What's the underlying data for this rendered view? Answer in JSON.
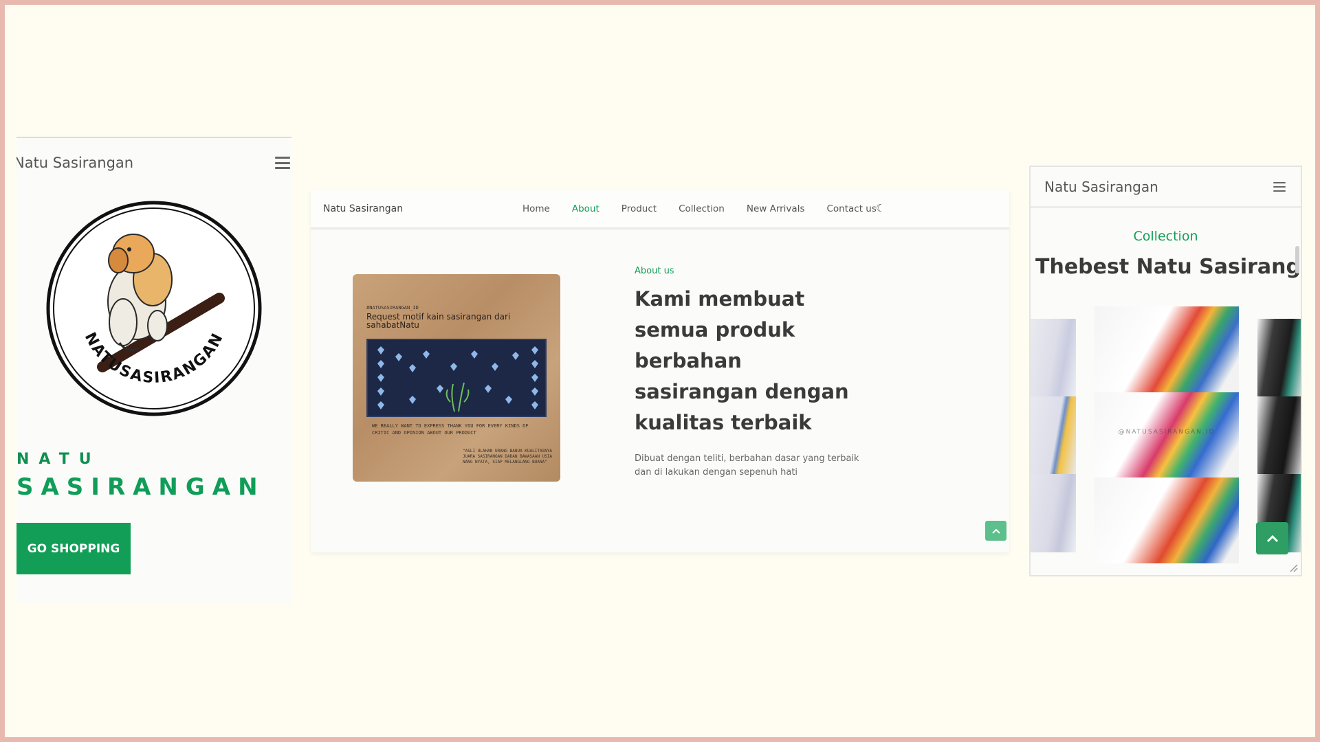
{
  "left_mobile": {
    "brand": "Natu Sasirangan",
    "logo_text": "NATUSASIRANGAN",
    "hero_line1": "NATU",
    "hero_line2": "SASIRANGAN",
    "cta_label": "GO SHOPPING"
  },
  "desktop": {
    "brand": "Natu Sasirangan",
    "nav": [
      {
        "label": "Home",
        "active": false
      },
      {
        "label": "About",
        "active": true
      },
      {
        "label": "Product",
        "active": false
      },
      {
        "label": "Collection",
        "active": false
      },
      {
        "label": "New Arrivals",
        "active": false
      },
      {
        "label": "Contact us",
        "active": false
      }
    ],
    "theme_icon": "moon-icon",
    "photo": {
      "handle": "#NATUSASIRANGAN_ID",
      "title": "Request motif kain sasirangan dari sahabatNatu",
      "thanks": "WE REALLY WANT TO EXPRESS THANK YOU FOR EVERY KINDS OF CRITIC AND OPINION ABOUT OUR PRODUCT",
      "quote": "\"ASLI ULAHAN URANG BANUA KUALITASNYA JUARA SASIRANGAN DADAN BAWASAAN USIA NANG NYATA, SIAP MELANGLANG BUANA\""
    },
    "about_label": "About us",
    "about_heading": "Kami membuat semua produk berbahan sasirangan dengan kualitas terbaik",
    "about_desc": "Dibuat dengan teliti, berbahan dasar yang terbaik dan di lakukan dengan sepenuh hati"
  },
  "right_mobile": {
    "brand": "Natu Sasirangan",
    "section_label": "Collection",
    "section_title": "Thebest Natu Sasirangan",
    "watermark": "@NATUSASIRANGAN.ID"
  },
  "colors": {
    "accent": "#129e56",
    "background": "#fffdf1",
    "frame": "#e8b9af"
  }
}
